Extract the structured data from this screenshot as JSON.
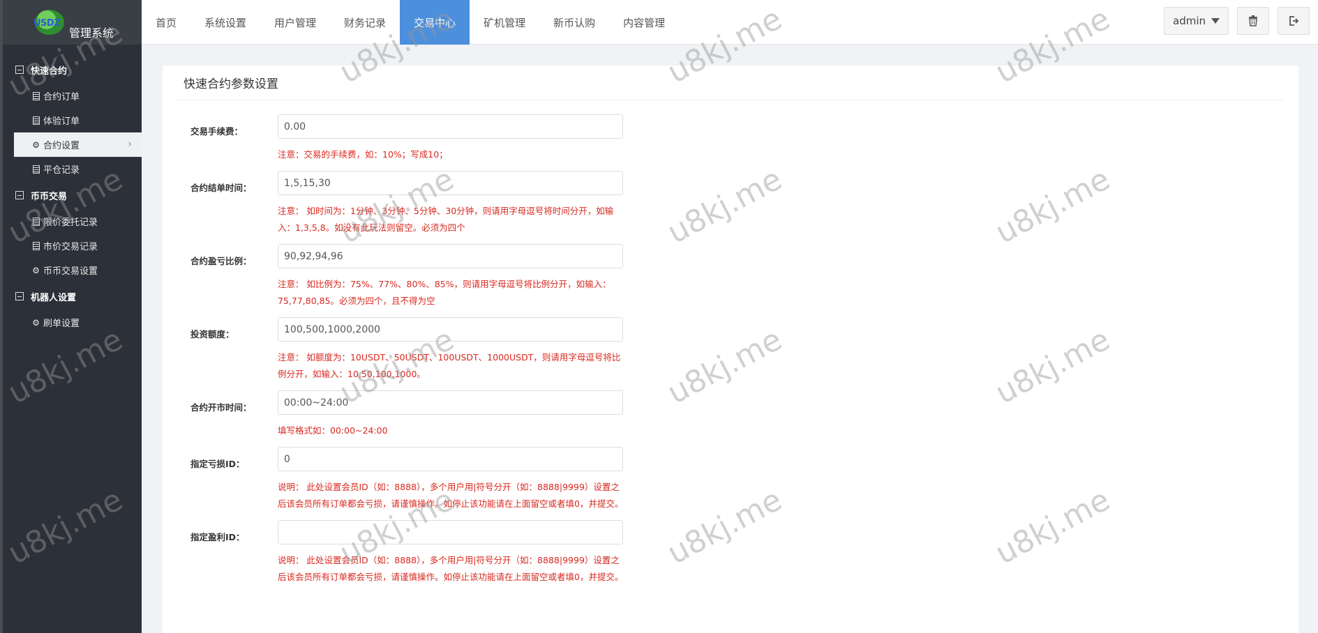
{
  "brand": {
    "logo_text": "USDZ",
    "name": "管理系统"
  },
  "sidebar": {
    "groups": [
      {
        "label": "快速合约",
        "items": [
          {
            "label": "合约订单",
            "icon": "document-icon"
          },
          {
            "label": "体验订单",
            "icon": "document-icon"
          },
          {
            "label": "合约设置",
            "icon": "gear-icon",
            "active": true
          },
          {
            "label": "平仓记录",
            "icon": "document-icon"
          }
        ]
      },
      {
        "label": "币币交易",
        "items": [
          {
            "label": "限价委托记录",
            "icon": "document-icon"
          },
          {
            "label": "市价交易记录",
            "icon": "document-icon"
          },
          {
            "label": "币币交易设置",
            "icon": "gear-icon"
          }
        ]
      },
      {
        "label": "机器人设置",
        "items": [
          {
            "label": "刷单设置",
            "icon": "gear-icon"
          }
        ]
      }
    ]
  },
  "nav": {
    "tabs": [
      "首页",
      "系统设置",
      "用户管理",
      "财务记录",
      "交易中心",
      "矿机管理",
      "新币认购",
      "内容管理"
    ],
    "active": "交易中心"
  },
  "topright": {
    "user": "admin"
  },
  "panel": {
    "title": "快速合约参数设置",
    "fields": [
      {
        "label": "交易手续费：",
        "value": "0.00",
        "note": "注意：交易的手续费，如：10%；写成10；"
      },
      {
        "label": "合约结单时间：",
        "value": "1,5,15,30",
        "note": "注意： 如时间为：1分钟、3分钟、5分钟、30分钟，则请用字母逗号将时间分开，如输入：1,3,5,8。如没有此玩法则留空。必须为四个"
      },
      {
        "label": "合约盈亏比例：",
        "value": "90,92,94,96",
        "note": "注意： 如比例为：75%、77%、80%、85%，则请用字母逗号将比例分开，如输入：75,77,80,85。必须为四个，且不得为空"
      },
      {
        "label": "投资额度：",
        "value": "100,500,1000,2000",
        "note": "注意： 如额度为：10USDT、50USDT、100USDT、1000USDT，则请用字母逗号将比例分开，如输入：10,50,100,1000。"
      },
      {
        "label": "合约开市时间：",
        "value": "00:00~24:00",
        "note": "填写格式如：00:00~24:00"
      },
      {
        "label": "指定亏损ID：",
        "value": "0",
        "note": "说明： 此处设置会员ID（如：8888），多个用户用|符号分开（如：8888|9999）设置之后该会员所有订单都会亏损，请谨慎操作。如停止该功能请在上面留空或者填0，并提交。"
      },
      {
        "label": "指定盈利ID：",
        "value": "",
        "note": "说明： 此处设置会员ID（如：8888），多个用户用|符号分开（如：8888|9999）设置之后该会员所有订单都会亏损，请谨慎操作。如停止该功能请在上面留空或者填0，并提交。"
      }
    ]
  },
  "watermark": "u8kj.me"
}
